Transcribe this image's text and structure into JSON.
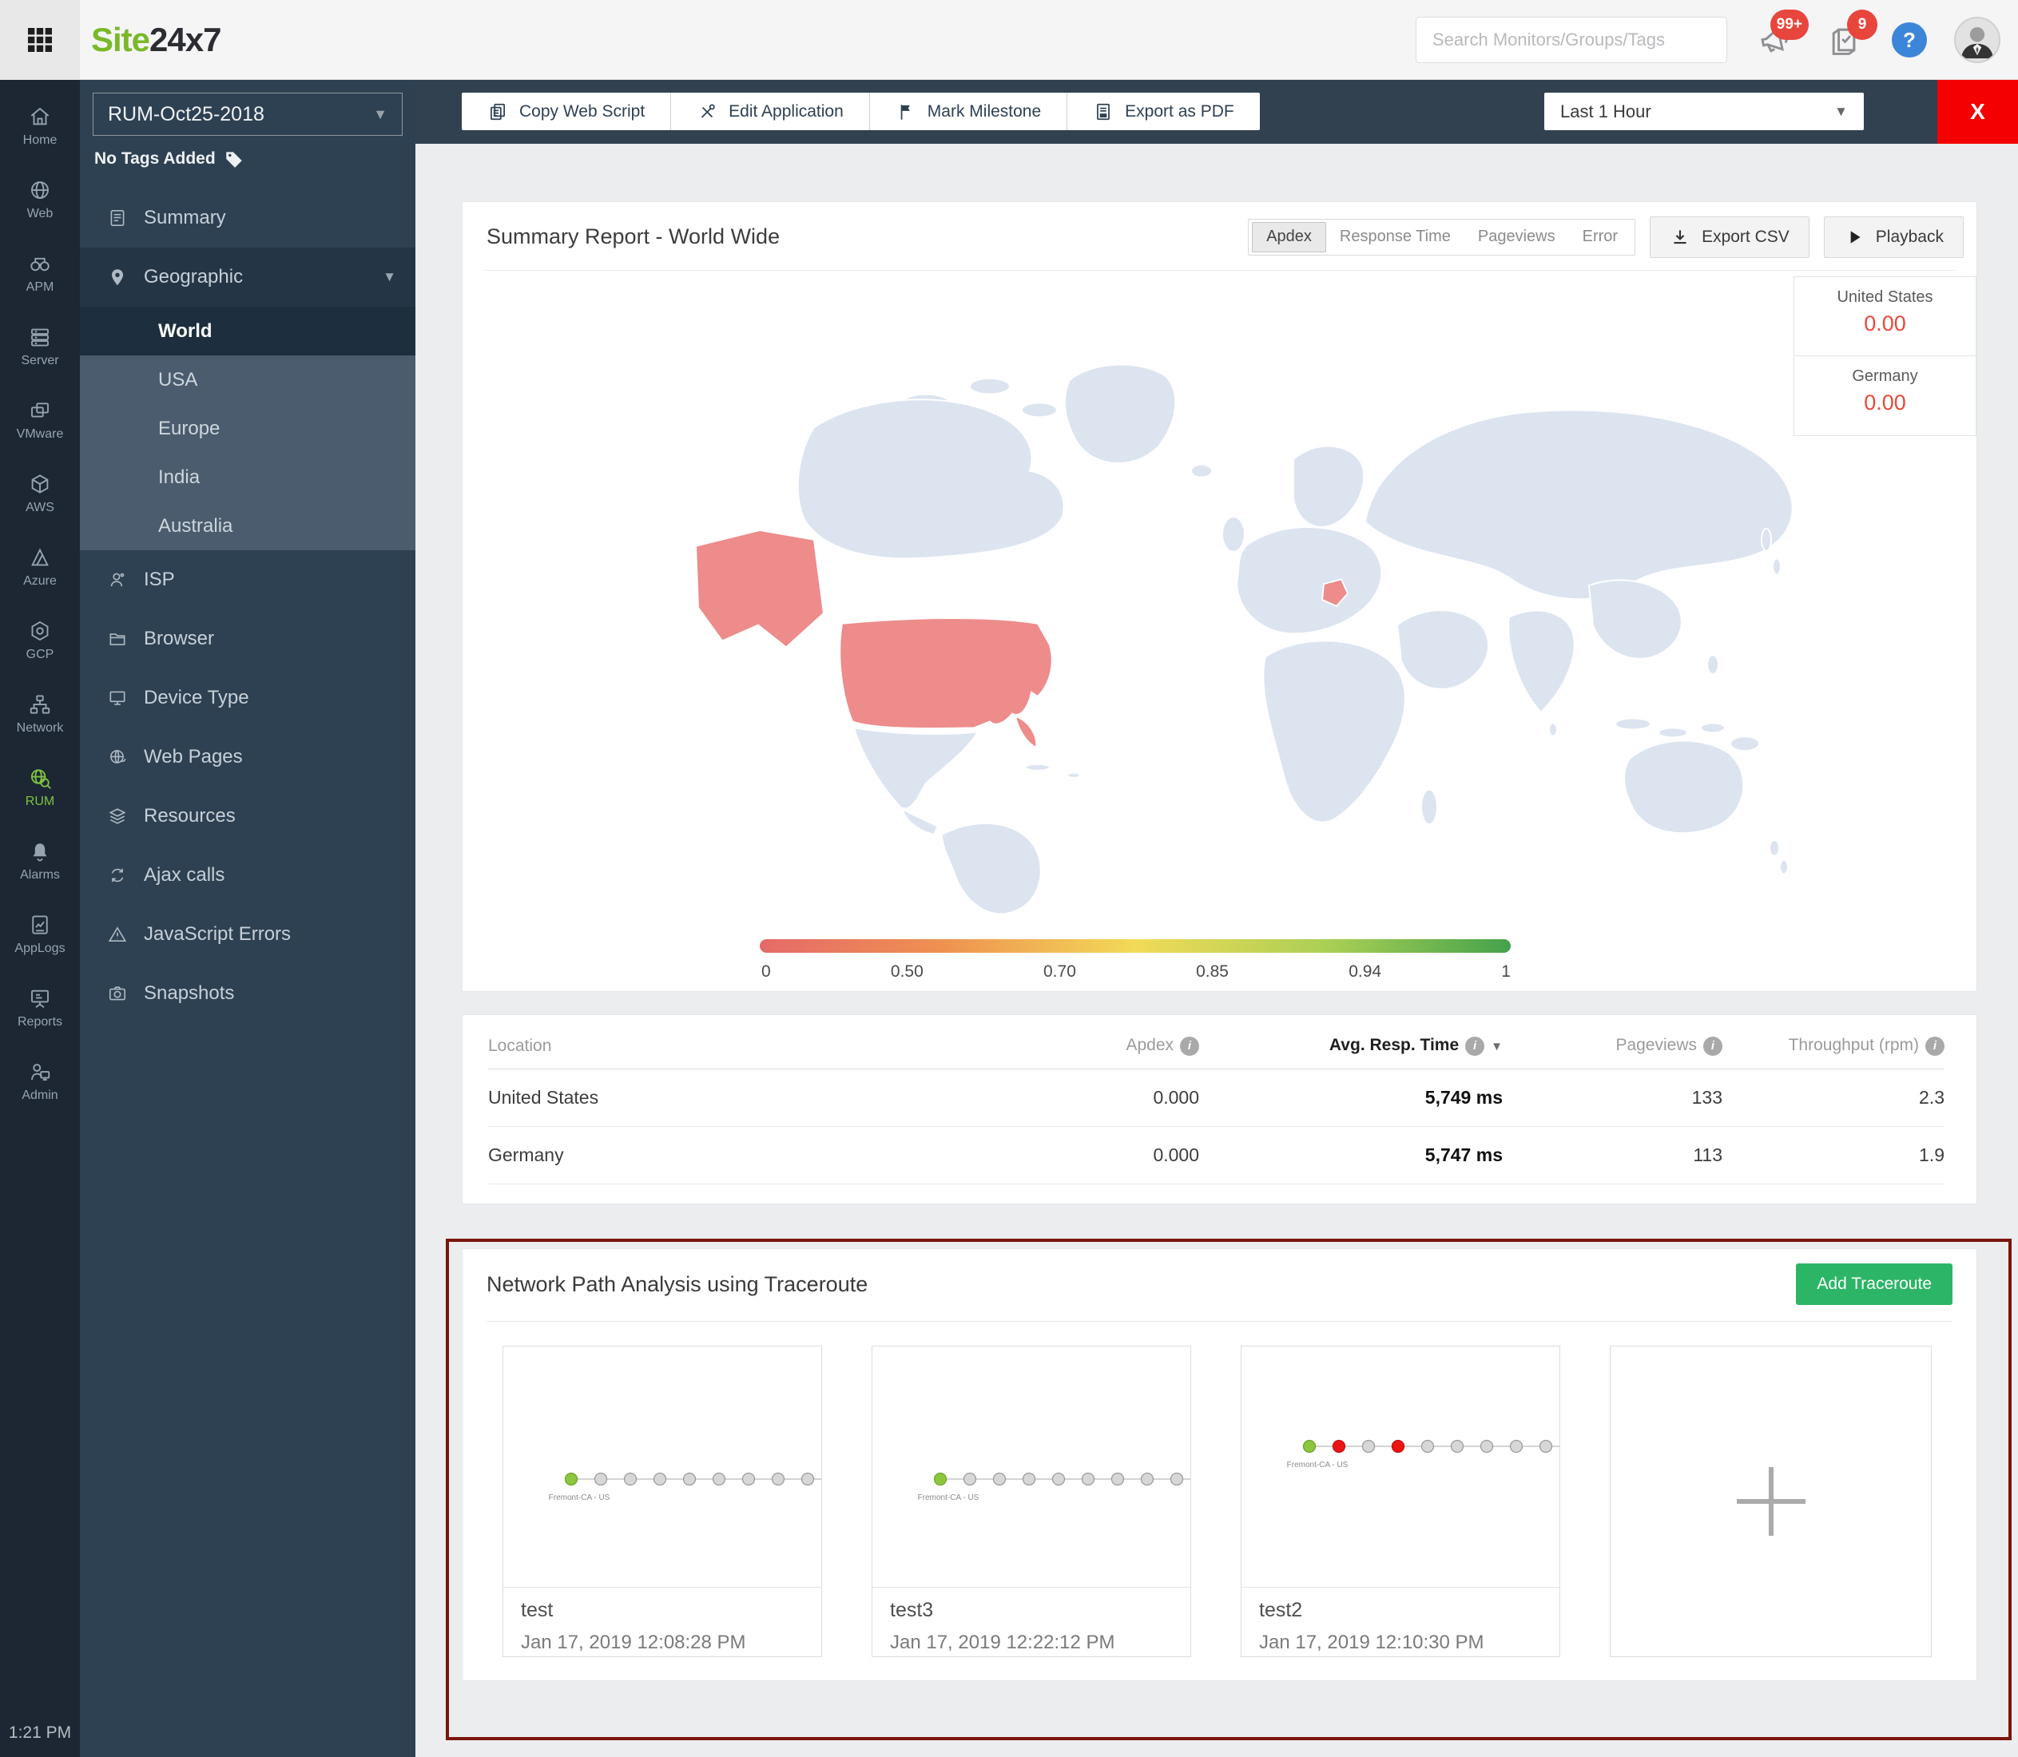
{
  "colors": {
    "brand_green": "#79b928",
    "rail_active_green": "#7fc241",
    "badge_red": "#e8453c",
    "help_blue": "#3b86d8",
    "close_red": "#f40000",
    "apdex_value_red": "#e64a3c",
    "map_land": "#dce4f0",
    "map_highlight": "#ee8b8b",
    "add_button_green": "#2cb567",
    "section_highlight_border": "#7b150c",
    "node_green": "#8cc63f",
    "node_gray": "#d7d7d7",
    "node_red": "#ee1414"
  },
  "topbar": {
    "logo_site": "Site",
    "logo_rest": "24x7",
    "search_placeholder": "Search Monitors/Groups/Tags",
    "announcements_badge": "99+",
    "tasks_badge": "9",
    "help_label": "?"
  },
  "rail": {
    "items": [
      {
        "label": "Home"
      },
      {
        "label": "Web"
      },
      {
        "label": "APM"
      },
      {
        "label": "Server"
      },
      {
        "label": "VMware"
      },
      {
        "label": "AWS"
      },
      {
        "label": "Azure"
      },
      {
        "label": "GCP"
      },
      {
        "label": "Network"
      },
      {
        "label": "RUM",
        "active": true
      },
      {
        "label": "Alarms"
      },
      {
        "label": "AppLogs"
      },
      {
        "label": "Reports"
      },
      {
        "label": "Admin"
      }
    ],
    "clock": "1:21 PM"
  },
  "sidebar": {
    "monitor_name": "RUM-Oct25-2018",
    "tags_label": "No Tags Added",
    "items": {
      "summary": "Summary",
      "geographic": "Geographic",
      "world": "World",
      "usa": "USA",
      "europe": "Europe",
      "india": "India",
      "australia": "Australia",
      "isp": "ISP",
      "browser": "Browser",
      "device_type": "Device Type",
      "web_pages": "Web Pages",
      "resources": "Resources",
      "ajax_calls": "Ajax calls",
      "javascript_errors": "JavaScript Errors",
      "snapshots": "Snapshots"
    }
  },
  "toolbar": {
    "copy_web_script": "Copy Web Script",
    "edit_application": "Edit Application",
    "mark_milestone": "Mark Milestone",
    "export_as_pdf": "Export as PDF",
    "time_range": "Last 1 Hour",
    "close_label": "X"
  },
  "summary": {
    "title": "Summary Report - World Wide",
    "tabs": [
      {
        "label": "Apdex",
        "selected": true
      },
      {
        "label": "Response Time",
        "selected": false
      },
      {
        "label": "Pageviews",
        "selected": false
      },
      {
        "label": "Error",
        "selected": false
      }
    ],
    "export_csv": "Export CSV",
    "playback": "Playback",
    "side_panel": [
      {
        "country": "United States",
        "value": "0.00"
      },
      {
        "country": "Germany",
        "value": "0.00"
      }
    ],
    "legend_ticks": [
      "0",
      "0.50",
      "0.70",
      "0.85",
      "0.94",
      "1"
    ]
  },
  "geo_table": {
    "headers": {
      "location": "Location",
      "apdex": "Apdex",
      "avg_resp": "Avg. Resp. Time",
      "pageviews": "Pageviews",
      "throughput": "Throughput (rpm)"
    },
    "rows": [
      {
        "location": "United States",
        "apdex": "0.000",
        "avg_resp": "5,749 ms",
        "pageviews": "133",
        "throughput": "2.3"
      },
      {
        "location": "Germany",
        "apdex": "0.000",
        "avg_resp": "5,747 ms",
        "pageviews": "113",
        "throughput": "1.9"
      }
    ]
  },
  "traceroute": {
    "title": "Network Path Analysis using Traceroute",
    "add_button": "Add Traceroute",
    "cards": [
      {
        "name": "test",
        "timestamp": "Jan 17, 2019 12:08:28 PM",
        "origin_label": "Fremont-CA - US",
        "nodes": [
          "green",
          "gray",
          "gray",
          "gray",
          "gray",
          "gray",
          "gray",
          "gray",
          "gray"
        ]
      },
      {
        "name": "test3",
        "timestamp": "Jan 17, 2019 12:22:12 PM",
        "origin_label": "Fremont-CA - US",
        "nodes": [
          "green",
          "gray",
          "gray",
          "gray",
          "gray",
          "gray",
          "gray",
          "gray",
          "gray"
        ]
      },
      {
        "name": "test2",
        "timestamp": "Jan 17, 2019 12:10:30 PM",
        "origin_label": "Fremont-CA - US",
        "nodes": [
          "green",
          "red",
          "gray",
          "red",
          "gray",
          "gray",
          "gray",
          "gray",
          "gray"
        ]
      }
    ]
  }
}
